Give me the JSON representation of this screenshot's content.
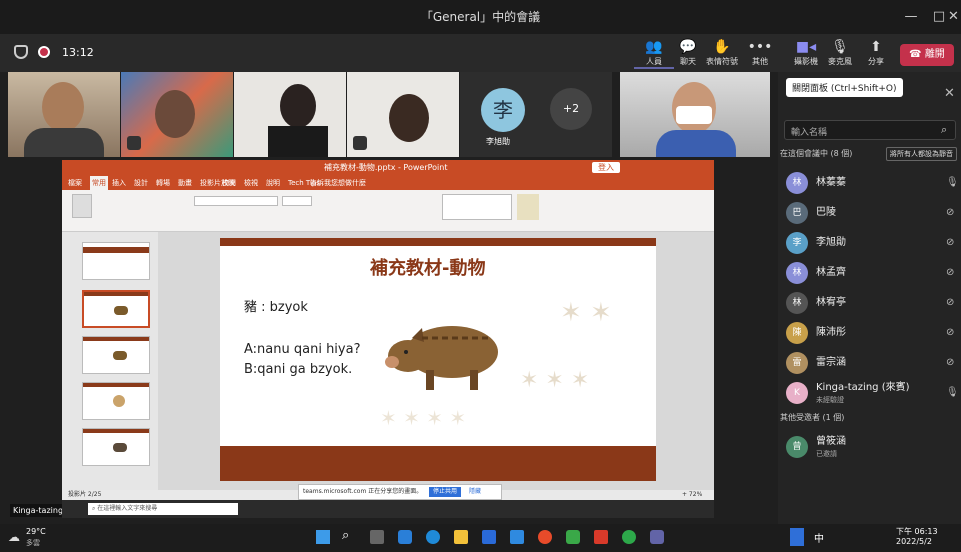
{
  "window": {
    "title": "「General」中的會議"
  },
  "meeting": {
    "timer": "13:12"
  },
  "toolbar": {
    "people": "人員",
    "chat": "聊天",
    "react": "表情符號",
    "more": "其他",
    "camera": "攝影機",
    "mic": "麥克風",
    "share": "分享",
    "leave": "離開"
  },
  "tiles": [
    {
      "initial": "李",
      "name": "李旭勛"
    },
    {
      "count": "+2"
    }
  ],
  "sidepanel": {
    "tooltip": "關閉面板 (Ctrl+Shift+O)",
    "search_placeholder": "輸入名稱",
    "section_in": "在這個會議中 (8 個)",
    "mute_all": "將所有人都設為靜音",
    "section_other": "其他受邀者 (1 個)",
    "people": [
      {
        "name": "林蓁蓁",
        "initial": "林",
        "color": "#8a8fd8"
      },
      {
        "name": "巴陵",
        "initial": "巴",
        "color": "#5a6b7a"
      },
      {
        "name": "李旭勛",
        "initial": "李",
        "color": "#5aa0c8"
      },
      {
        "name": "林孟齊",
        "initial": "林",
        "color": "#8a8fd8"
      },
      {
        "name": "林宥亭",
        "initial": "林",
        "color": "#555"
      },
      {
        "name": "陳沛彤",
        "initial": "陳",
        "color": "#c8a04a"
      },
      {
        "name": "雷宗涵",
        "initial": "雷",
        "color": "#b09060"
      },
      {
        "name": "Kinga-tazing (來賓)",
        "initial": "K",
        "color": "#e8b0c8",
        "sub": "未經驗證"
      }
    ],
    "invited": {
      "name": "曾筱涵",
      "initial": "曾",
      "sub": "已邀請"
    }
  },
  "ppt": {
    "title": "補充教材-動物.pptx - PowerPoint",
    "tabs": [
      "檔案",
      "常用",
      "插入",
      "設計",
      "轉場",
      "動畫",
      "投影片放映",
      "校閱",
      "檢視",
      "說明",
      "Tech Tips",
      "告訴我您想做什麼"
    ],
    "status": "投影片 2/25",
    "zoom": "+ 72%"
  },
  "slide": {
    "title": "補充教材-動物",
    "word": "豬 : bzyok",
    "q": "A:nanu qani hiya?",
    "a": "B:qani ga bzyok."
  },
  "notify": {
    "text": "teams.microsoft.com 正在分享您的畫面。",
    "stop": "停止共用",
    "hide": "隱藏"
  },
  "presenter": {
    "name": "Kinga-tazing (來賓)"
  },
  "taskbar": {
    "weather": "29°C",
    "weather_sub": "多雲",
    "search": "在這裡輸入文字來搜尋",
    "time": "下午 06:13",
    "date": "2022/5/2"
  },
  "colors": {
    "accent": "#6264a7",
    "leave": "#c4314b",
    "ppt": "#c84b25"
  }
}
